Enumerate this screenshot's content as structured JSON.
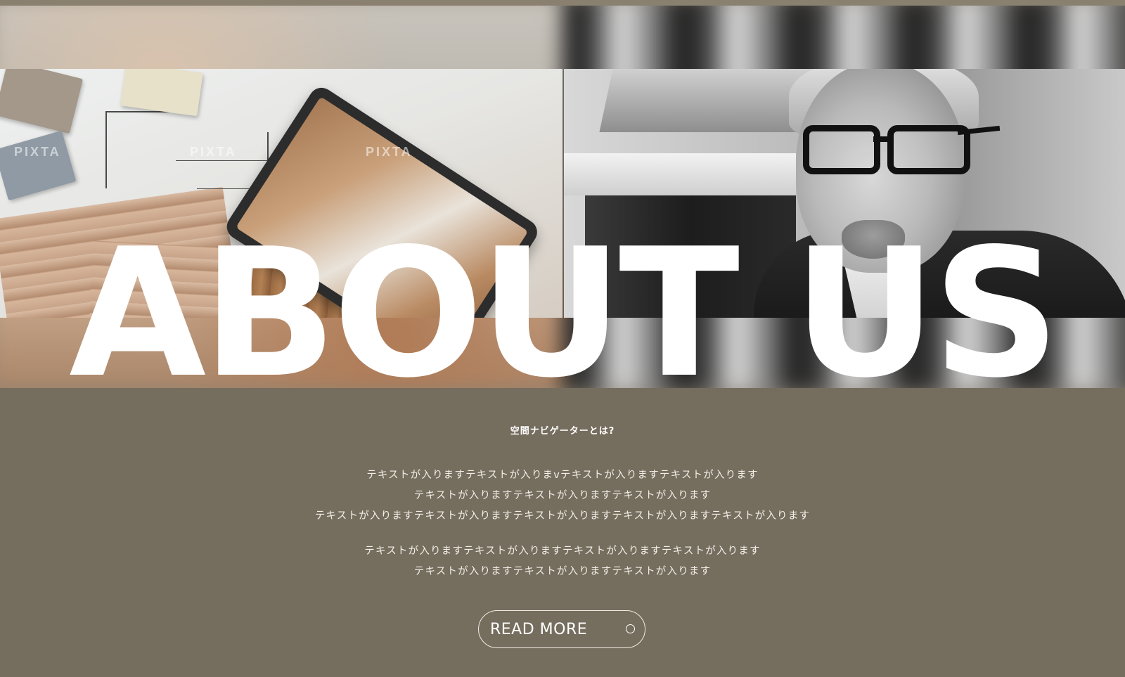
{
  "hero": {
    "title": "ABOUT US",
    "watermark_text": "PIXTA"
  },
  "content": {
    "subheading": "空間ナビゲーターとは?",
    "paragraph_1": [
      "テキストが入りますテキストが入りまvテキストが入りますテキストが入ります",
      "テキストが入りますテキストが入りますテキストが入ります",
      "テキストが入りますテキストが入りますテキストが入りますテキストが入りますテキストが入ります"
    ],
    "paragraph_2": [
      "テキストが入りますテキストが入りますテキストが入りますテキストが入ります",
      "テキストが入りますテキストが入りますテキストが入ります"
    ]
  },
  "read_more": {
    "label": "READ MORE",
    "icon": "circle-icon"
  },
  "colors": {
    "background": "#756d5e",
    "text": "#ffffff",
    "button_border": "#f1ece3"
  }
}
